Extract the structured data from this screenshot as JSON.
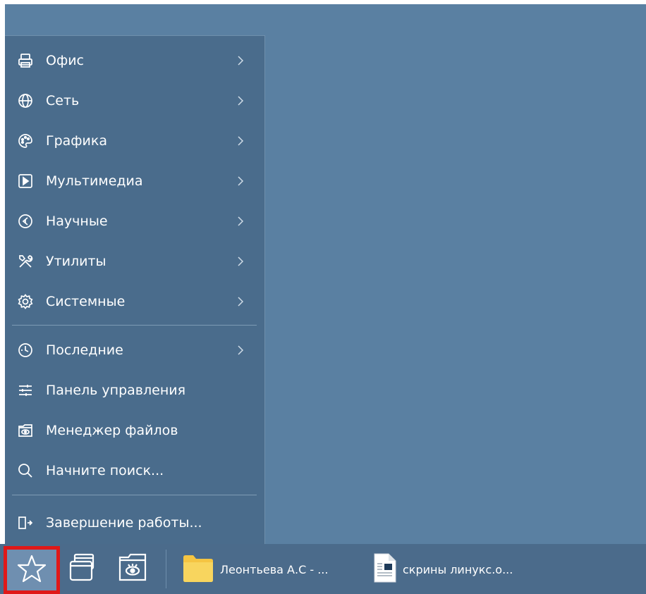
{
  "menu": {
    "items": [
      {
        "label": "Офис",
        "icon": "printer-icon",
        "submenu": true
      },
      {
        "label": "Сеть",
        "icon": "globe-icon",
        "submenu": true
      },
      {
        "label": "Графика",
        "icon": "palette-icon",
        "submenu": true
      },
      {
        "label": "Мультимедиа",
        "icon": "play-icon",
        "submenu": true
      },
      {
        "label": "Научные",
        "icon": "science-icon",
        "submenu": true
      },
      {
        "label": "Утилиты",
        "icon": "tools-icon",
        "submenu": true
      },
      {
        "label": "Системные",
        "icon": "gear-icon",
        "submenu": true
      }
    ],
    "recent": {
      "label": "Последние",
      "icon": "clock-icon",
      "submenu": true
    },
    "control_panel": {
      "label": "Панель управления",
      "icon": "sliders-icon"
    },
    "file_manager": {
      "label": "Менеджер файлов",
      "icon": "file-manager-icon"
    },
    "search": {
      "label": "Начните поиск...",
      "icon": "search-icon"
    },
    "shutdown": {
      "label": "Завершение работы...",
      "icon": "logout-icon"
    }
  },
  "taskbar": {
    "start_icon": "star-icon",
    "tasks": [
      {
        "label": "Леонтьева А.С - ...",
        "icon": "folder-icon"
      },
      {
        "label": "скрины линукс.о...",
        "icon": "document-icon"
      }
    ]
  },
  "colors": {
    "desktop": "#5a80a2",
    "menu": "#4a6c8c",
    "taskbar": "#4b6b8b",
    "start_highlight": "#e01818",
    "folder": "#f5c542"
  }
}
